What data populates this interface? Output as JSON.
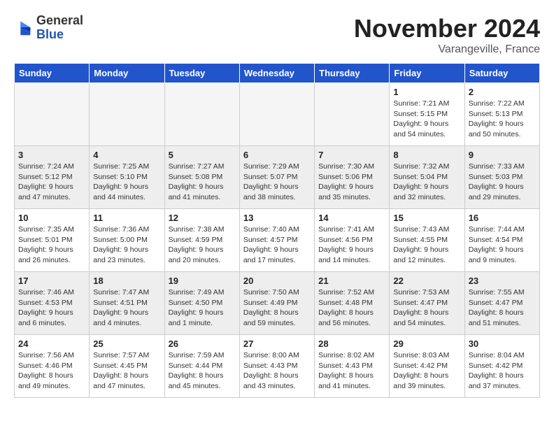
{
  "logo": {
    "general": "General",
    "blue": "Blue"
  },
  "title": "November 2024",
  "location": "Varangeville, France",
  "days_of_week": [
    "Sunday",
    "Monday",
    "Tuesday",
    "Wednesday",
    "Thursday",
    "Friday",
    "Saturday"
  ],
  "weeks": [
    [
      {
        "day": "",
        "info": ""
      },
      {
        "day": "",
        "info": ""
      },
      {
        "day": "",
        "info": ""
      },
      {
        "day": "",
        "info": ""
      },
      {
        "day": "",
        "info": ""
      },
      {
        "day": "1",
        "info": "Sunrise: 7:21 AM\nSunset: 5:15 PM\nDaylight: 9 hours\nand 54 minutes."
      },
      {
        "day": "2",
        "info": "Sunrise: 7:22 AM\nSunset: 5:13 PM\nDaylight: 9 hours\nand 50 minutes."
      }
    ],
    [
      {
        "day": "3",
        "info": "Sunrise: 7:24 AM\nSunset: 5:12 PM\nDaylight: 9 hours\nand 47 minutes."
      },
      {
        "day": "4",
        "info": "Sunrise: 7:25 AM\nSunset: 5:10 PM\nDaylight: 9 hours\nand 44 minutes."
      },
      {
        "day": "5",
        "info": "Sunrise: 7:27 AM\nSunset: 5:08 PM\nDaylight: 9 hours\nand 41 minutes."
      },
      {
        "day": "6",
        "info": "Sunrise: 7:29 AM\nSunset: 5:07 PM\nDaylight: 9 hours\nand 38 minutes."
      },
      {
        "day": "7",
        "info": "Sunrise: 7:30 AM\nSunset: 5:06 PM\nDaylight: 9 hours\nand 35 minutes."
      },
      {
        "day": "8",
        "info": "Sunrise: 7:32 AM\nSunset: 5:04 PM\nDaylight: 9 hours\nand 32 minutes."
      },
      {
        "day": "9",
        "info": "Sunrise: 7:33 AM\nSunset: 5:03 PM\nDaylight: 9 hours\nand 29 minutes."
      }
    ],
    [
      {
        "day": "10",
        "info": "Sunrise: 7:35 AM\nSunset: 5:01 PM\nDaylight: 9 hours\nand 26 minutes."
      },
      {
        "day": "11",
        "info": "Sunrise: 7:36 AM\nSunset: 5:00 PM\nDaylight: 9 hours\nand 23 minutes."
      },
      {
        "day": "12",
        "info": "Sunrise: 7:38 AM\nSunset: 4:59 PM\nDaylight: 9 hours\nand 20 minutes."
      },
      {
        "day": "13",
        "info": "Sunrise: 7:40 AM\nSunset: 4:57 PM\nDaylight: 9 hours\nand 17 minutes."
      },
      {
        "day": "14",
        "info": "Sunrise: 7:41 AM\nSunset: 4:56 PM\nDaylight: 9 hours\nand 14 minutes."
      },
      {
        "day": "15",
        "info": "Sunrise: 7:43 AM\nSunset: 4:55 PM\nDaylight: 9 hours\nand 12 minutes."
      },
      {
        "day": "16",
        "info": "Sunrise: 7:44 AM\nSunset: 4:54 PM\nDaylight: 9 hours\nand 9 minutes."
      }
    ],
    [
      {
        "day": "17",
        "info": "Sunrise: 7:46 AM\nSunset: 4:53 PM\nDaylight: 9 hours\nand 6 minutes."
      },
      {
        "day": "18",
        "info": "Sunrise: 7:47 AM\nSunset: 4:51 PM\nDaylight: 9 hours\nand 4 minutes."
      },
      {
        "day": "19",
        "info": "Sunrise: 7:49 AM\nSunset: 4:50 PM\nDaylight: 9 hours\nand 1 minute."
      },
      {
        "day": "20",
        "info": "Sunrise: 7:50 AM\nSunset: 4:49 PM\nDaylight: 8 hours\nand 59 minutes."
      },
      {
        "day": "21",
        "info": "Sunrise: 7:52 AM\nSunset: 4:48 PM\nDaylight: 8 hours\nand 56 minutes."
      },
      {
        "day": "22",
        "info": "Sunrise: 7:53 AM\nSunset: 4:47 PM\nDaylight: 8 hours\nand 54 minutes."
      },
      {
        "day": "23",
        "info": "Sunrise: 7:55 AM\nSunset: 4:47 PM\nDaylight: 8 hours\nand 51 minutes."
      }
    ],
    [
      {
        "day": "24",
        "info": "Sunrise: 7:56 AM\nSunset: 4:46 PM\nDaylight: 8 hours\nand 49 minutes."
      },
      {
        "day": "25",
        "info": "Sunrise: 7:57 AM\nSunset: 4:45 PM\nDaylight: 8 hours\nand 47 minutes."
      },
      {
        "day": "26",
        "info": "Sunrise: 7:59 AM\nSunset: 4:44 PM\nDaylight: 8 hours\nand 45 minutes."
      },
      {
        "day": "27",
        "info": "Sunrise: 8:00 AM\nSunset: 4:43 PM\nDaylight: 8 hours\nand 43 minutes."
      },
      {
        "day": "28",
        "info": "Sunrise: 8:02 AM\nSunset: 4:43 PM\nDaylight: 8 hours\nand 41 minutes."
      },
      {
        "day": "29",
        "info": "Sunrise: 8:03 AM\nSunset: 4:42 PM\nDaylight: 8 hours\nand 39 minutes."
      },
      {
        "day": "30",
        "info": "Sunrise: 8:04 AM\nSunset: 4:42 PM\nDaylight: 8 hours\nand 37 minutes."
      }
    ]
  ]
}
